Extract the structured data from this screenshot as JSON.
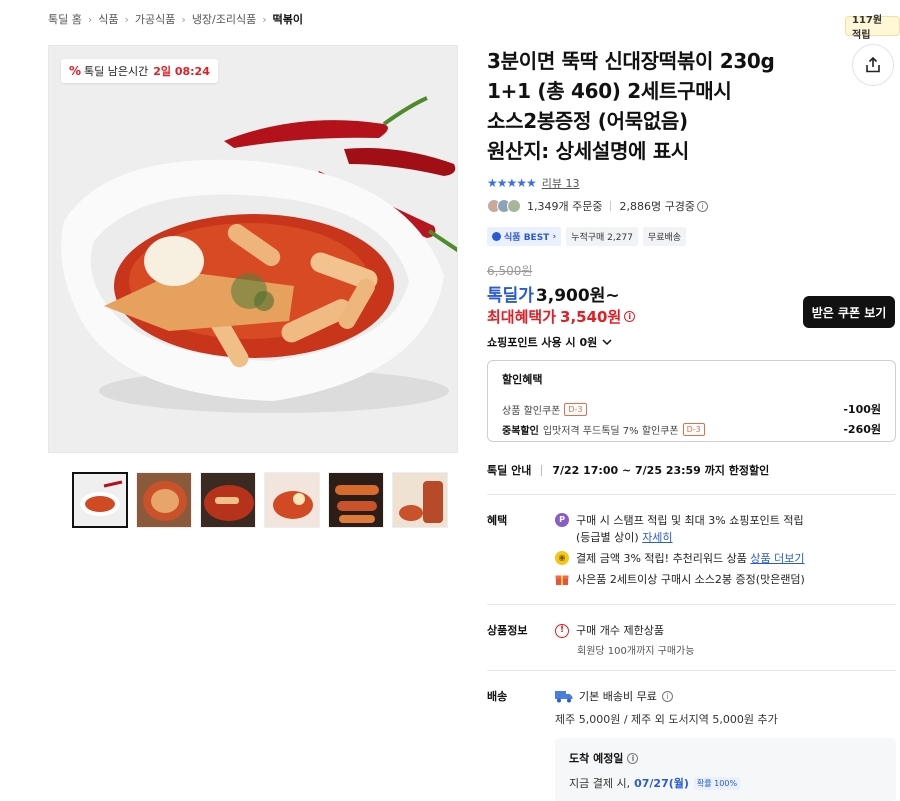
{
  "breadcrumb": [
    "톡딜 홈",
    "식품",
    "가공식품",
    "냉장/조리식품",
    "떡볶이"
  ],
  "timer": {
    "label": "톡딜 남은시간",
    "value": "2일 08:24"
  },
  "share": {
    "tooltip": "117원 적립"
  },
  "product": {
    "title_lines": [
      "3분이면 뚝딱 신대장떡볶이 230g",
      "1+1 (총 460) 2세트구매시",
      "소스2봉증정 (어묵없음)",
      "원산지: 상세설명에 표시"
    ],
    "rating_stars": 5,
    "review_label": "리뷰 13",
    "orders": "1,349개 주문중",
    "viewers": "2,886명 구경중",
    "tags": [
      "식품 BEST",
      "누적구매 2,277",
      "무료배송"
    ]
  },
  "price": {
    "original": "6,500원",
    "deal_label": "톡딜가",
    "deal_value": "3,900원~",
    "max_label": "최대혜택가",
    "max_value": "3,540원",
    "coupon_button": "받은 쿠폰 보기",
    "points": "쇼핑포인트 사용 시 0원"
  },
  "discount": {
    "title": "할인혜택",
    "rows": [
      {
        "strong": "",
        "label": "상품 할인쿠폰",
        "dday": "D-3",
        "amount": "-100원"
      },
      {
        "strong": "중복할인",
        "label": "입맛저격 푸드톡딜 7% 할인쿠폰",
        "dday": "D-3",
        "amount": "-260원"
      }
    ]
  },
  "deal_info": {
    "label": "톡딜 안내",
    "value": "7/22 17:00 ~ 7/25 23:59 까지 한정할인"
  },
  "benefits": {
    "label": "혜택",
    "item1_text": "구매 시 스탬프 적립 및 최대 3% 쇼핑포인트 적립",
    "item1_sub": "(등급별 상이)",
    "item1_link": "자세히",
    "item2_text": "결제 금액 3% 적립! 추천리워드 상품",
    "item2_link": "상품 더보기",
    "item3_text": "사은품 2세트이상 구매시 소스2봉 증정(맛은랜덤)"
  },
  "product_info": {
    "label": "상품정보",
    "line1": "구매 개수 제한상품",
    "line2": "회원당 100개까지 구매가능"
  },
  "shipping": {
    "label": "배송",
    "line1": "기본 배송비 무료",
    "line2": "제주 5,000원 / 제주 외 도서지역 5,000원 추가",
    "arrival_title": "도착 예정일",
    "arrival_prefix": "지금 결제 시,",
    "arrival_date": "07/27(월)",
    "arrival_prob": "확률 100%"
  },
  "colors": {
    "accent": "#2a5bd7",
    "sale": "#e51c23",
    "dark_button": "#111111"
  }
}
